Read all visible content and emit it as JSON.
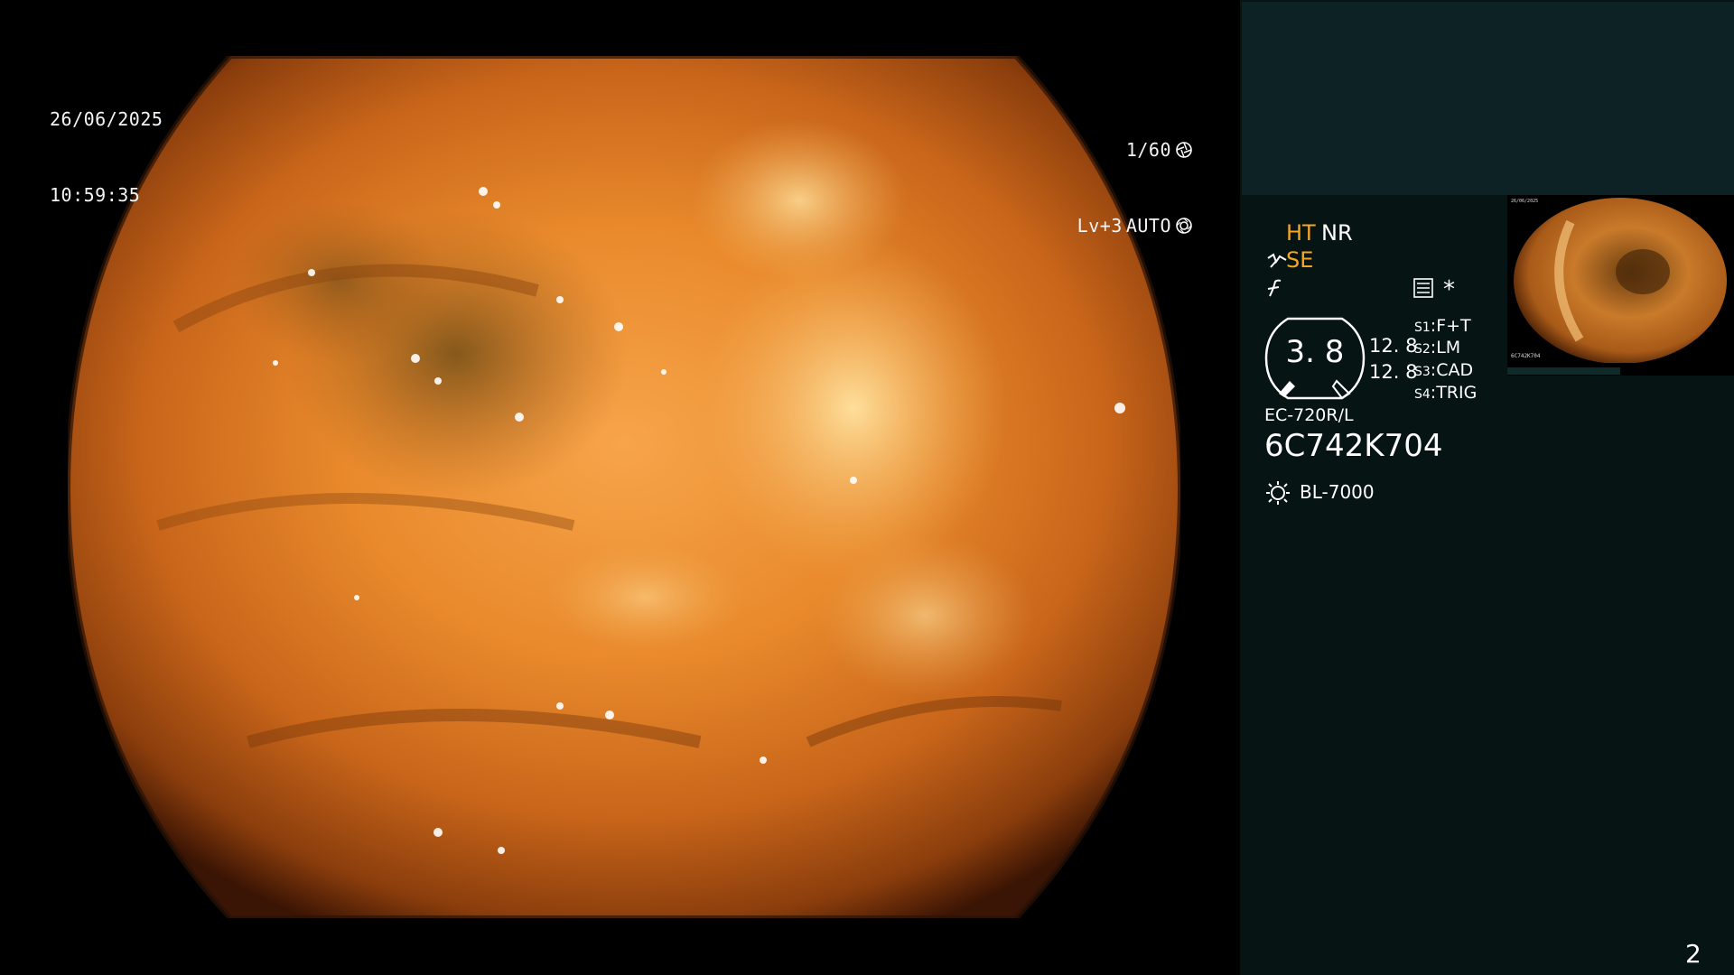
{
  "screen": {
    "background": "#000000",
    "panel_background": "#061414",
    "accent": "#f5a623"
  },
  "overlay": {
    "date": "26/06/2025",
    "time": "10:59:35",
    "shutter": "1/60",
    "level": "Lv+3",
    "iris_mode": "AUTO"
  },
  "image": {
    "description_icon": "endoscopic-image"
  },
  "panel": {
    "modes": {
      "ht": "HT",
      "nr": "NR",
      "se": "SE"
    },
    "asterisk": "*",
    "gauge": {
      "value": "3. 8",
      "value_top": "12. 8",
      "value_bottom": "12. 8"
    },
    "switches": [
      {
        "key": "S1",
        "label": "F+T"
      },
      {
        "key": "S2",
        "label": "LM"
      },
      {
        "key": "S3",
        "label": "CAD"
      },
      {
        "key": "S4",
        "label": "TRIG"
      }
    ],
    "scope_model": "EC-720R/L",
    "serial_number": "6C742K704",
    "light_source": "BL-7000",
    "page_number": "2"
  }
}
